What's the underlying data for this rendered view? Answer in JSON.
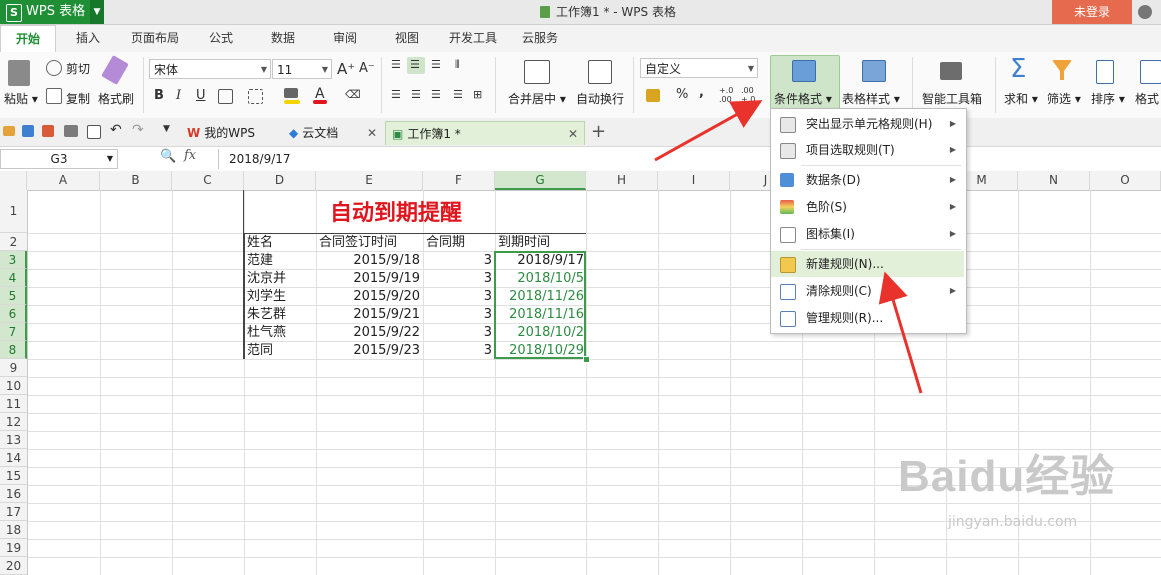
{
  "app": {
    "name": "WPS 表格",
    "logo_letter": "S",
    "doc_title": "工作簿1 * - WPS 表格",
    "login": "未登录"
  },
  "tabs": [
    "开始",
    "插入",
    "页面布局",
    "公式",
    "数据",
    "审阅",
    "视图",
    "开发工具",
    "云服务"
  ],
  "ribbon": {
    "paste": "粘贴",
    "cut": "剪切",
    "copy": "复制",
    "format_painter": "格式刷",
    "font_name": "宋体",
    "font_size": "11",
    "merge_center": "合并居中",
    "wrap_text": "自动换行",
    "number_format": "自定义",
    "conditional_format": "条件格式",
    "table_style": "表格样式",
    "smart_toolbox": "智能工具箱",
    "sum": "求和",
    "filter": "筛选",
    "sort": "排序",
    "format": "格式",
    "bold": "B",
    "italic": "I",
    "underline": "U",
    "percent": "%",
    "comma": ",",
    "inc_decimal": "+.0\n.00",
    "dec_decimal": ".00\n+.0"
  },
  "doc_tabs": [
    {
      "label": "我的WPS"
    },
    {
      "label": "云文档"
    },
    {
      "label": "工作簿1 *"
    }
  ],
  "formula_bar": {
    "name_box": "G3",
    "fx": "fx",
    "value": "2018/9/17"
  },
  "columns": [
    "A",
    "B",
    "C",
    "D",
    "E",
    "F",
    "G",
    "H",
    "I",
    "J",
    "K",
    "L",
    "M",
    "N",
    "O"
  ],
  "rows": [
    "1",
    "2",
    "3",
    "4",
    "5",
    "6",
    "7",
    "8",
    "9",
    "10",
    "11",
    "12",
    "13",
    "14",
    "15",
    "16",
    "17",
    "18",
    "19",
    "20"
  ],
  "sheet": {
    "title": "自动到期提醒",
    "headers": [
      "姓名",
      "合同签订时间",
      "合同期",
      "到期时间"
    ],
    "records": [
      {
        "name": "范建",
        "sign": "2015/9/18",
        "term": "3",
        "due": "2018/9/17"
      },
      {
        "name": "沈京并",
        "sign": "2015/9/19",
        "term": "3",
        "due": "2018/10/5"
      },
      {
        "name": "刘学生",
        "sign": "2015/9/20",
        "term": "3",
        "due": "2018/11/26"
      },
      {
        "name": "朱艺群",
        "sign": "2015/9/21",
        "term": "3",
        "due": "2018/11/16"
      },
      {
        "name": "杜气燕",
        "sign": "2015/9/22",
        "term": "3",
        "due": "2018/10/2"
      },
      {
        "name": "范同",
        "sign": "2015/9/23",
        "term": "3",
        "due": "2018/10/29"
      }
    ]
  },
  "menu": {
    "items": [
      {
        "label": "突出显示单元格规则(H)",
        "sub": true
      },
      {
        "label": "项目选取规则(T)",
        "sub": true
      },
      {
        "label": "数据条(D)",
        "sub": true
      },
      {
        "label": "色阶(S)",
        "sub": true
      },
      {
        "label": "图标集(I)",
        "sub": true
      },
      {
        "label": "新建规则(N)...",
        "sub": false
      },
      {
        "label": "清除规则(C)",
        "sub": true
      },
      {
        "label": "管理规则(R)...",
        "sub": false
      }
    ],
    "highlighted": "新建规则(N)..."
  },
  "watermark": {
    "brand": "Baidu经验",
    "url": "jingyan.baidu.com"
  },
  "colors": {
    "wps_green": "#1f8f36",
    "login_orange": "#e66a4d",
    "title_red": "#e0161e",
    "arrow_red": "#e8322b",
    "date_green": "#2e8b43"
  }
}
